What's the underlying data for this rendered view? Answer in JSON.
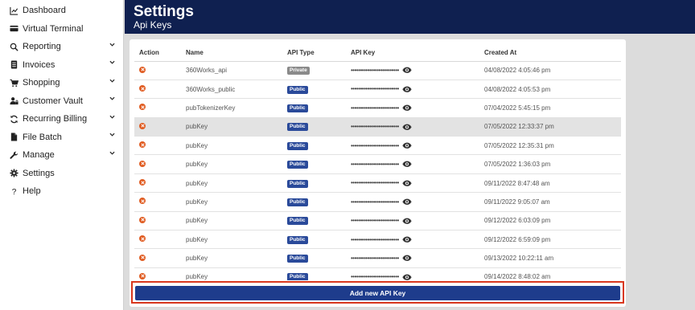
{
  "sidebar": {
    "items": [
      {
        "label": "Dashboard",
        "icon": "chart-line-icon",
        "has_chevron": false
      },
      {
        "label": "Virtual Terminal",
        "icon": "credit-card-icon",
        "has_chevron": false
      },
      {
        "label": "Reporting",
        "icon": "search-icon",
        "has_chevron": true
      },
      {
        "label": "Invoices",
        "icon": "invoice-icon",
        "has_chevron": true
      },
      {
        "label": "Shopping",
        "icon": "cart-icon",
        "has_chevron": true
      },
      {
        "label": "Customer Vault",
        "icon": "user-lock-icon",
        "has_chevron": true
      },
      {
        "label": "Recurring Billing",
        "icon": "sync-icon",
        "has_chevron": true
      },
      {
        "label": "File Batch",
        "icon": "file-icon",
        "has_chevron": true
      },
      {
        "label": "Manage",
        "icon": "wrench-icon",
        "has_chevron": true
      },
      {
        "label": "Settings",
        "icon": "gear-icon",
        "has_chevron": false
      },
      {
        "label": "Help",
        "icon": "question-icon",
        "has_chevron": false
      }
    ]
  },
  "header": {
    "title": "Settings",
    "subtitle": "Api Keys"
  },
  "table": {
    "columns": [
      "Action",
      "Name",
      "API Type",
      "API Key",
      "Created At"
    ],
    "masked_key": "••••••••••••••••••••••••••",
    "rows": [
      {
        "name": "360Works_api",
        "type": "Private",
        "created": "04/08/2022 4:05:46 pm"
      },
      {
        "name": "360Works_public",
        "type": "Public",
        "created": "04/08/2022 4:05:53 pm"
      },
      {
        "name": "pubTokenizerKey",
        "type": "Public",
        "created": "07/04/2022 5:45:15 pm"
      },
      {
        "name": "pubKey",
        "type": "Public",
        "created": "07/05/2022 12:33:37 pm"
      },
      {
        "name": "pubKey",
        "type": "Public",
        "created": "07/05/2022 12:35:31 pm"
      },
      {
        "name": "pubKey",
        "type": "Public",
        "created": "07/05/2022 1:36:03 pm"
      },
      {
        "name": "pubKey",
        "type": "Public",
        "created": "09/11/2022 8:47:48 am"
      },
      {
        "name": "pubKey",
        "type": "Public",
        "created": "09/11/2022 9:05:07 am"
      },
      {
        "name": "pubKey",
        "type": "Public",
        "created": "09/12/2022 6:03:09 pm"
      },
      {
        "name": "pubKey",
        "type": "Public",
        "created": "09/12/2022 6:59:09 pm"
      },
      {
        "name": "pubKey",
        "type": "Public",
        "created": "09/13/2022 10:22:11 am"
      },
      {
        "name": "pubKey",
        "type": "Public",
        "created": "09/14/2022 8:48:02 am"
      }
    ],
    "highlighted_row": 3
  },
  "actions": {
    "add_label": "Add new API Key"
  },
  "colors": {
    "header_bg": "#0f2050",
    "button_bg": "#1e3c8c",
    "delete_icon": "#e05b20",
    "public_badge": "#2a4a9a",
    "private_badge": "#8a8a8a",
    "highlight_border": "#d9381e"
  }
}
